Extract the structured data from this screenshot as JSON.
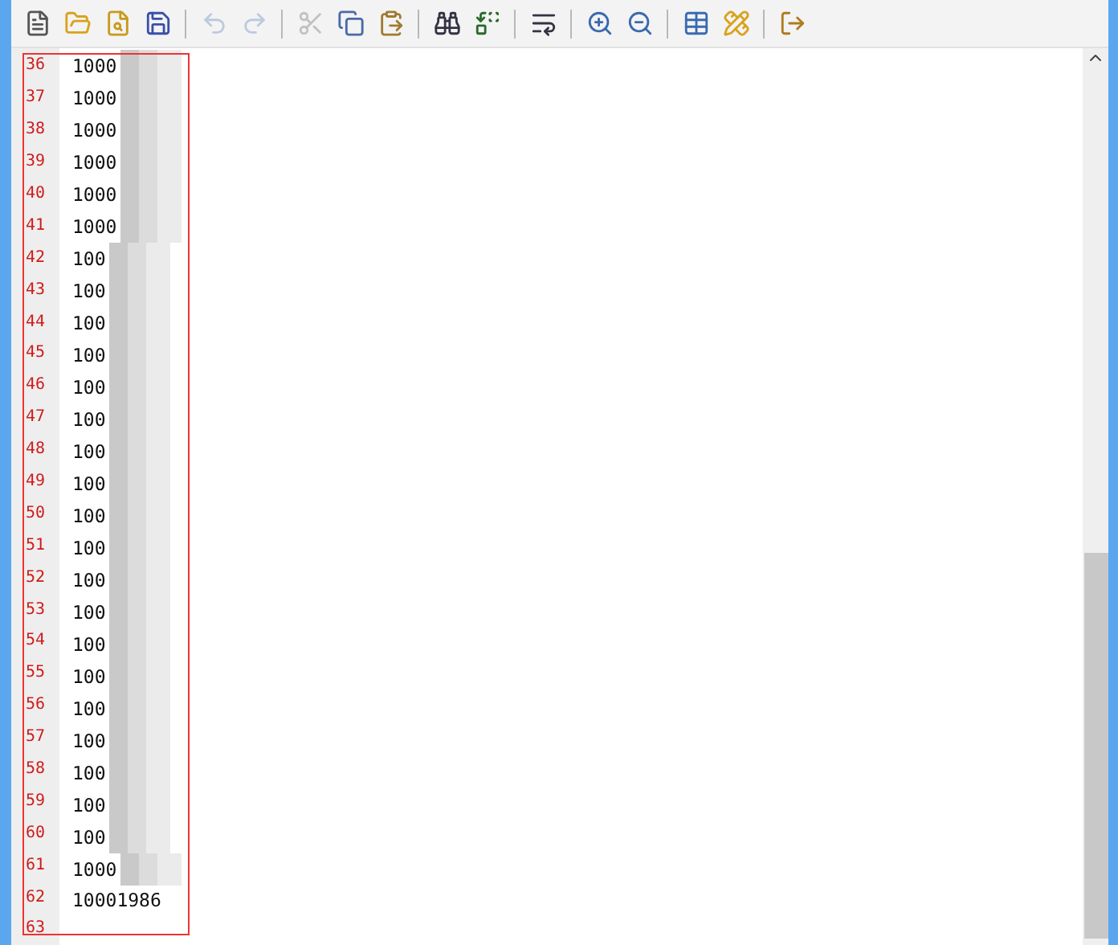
{
  "toolbar": [
    {
      "kind": "new"
    },
    {
      "kind": "open"
    },
    {
      "kind": "preview"
    },
    {
      "kind": "save"
    },
    {
      "kind": "sep"
    },
    {
      "kind": "undo",
      "disabled": true
    },
    {
      "kind": "redo",
      "disabled": true
    },
    {
      "kind": "sep"
    },
    {
      "kind": "cut",
      "disabled": true
    },
    {
      "kind": "copy"
    },
    {
      "kind": "paste"
    },
    {
      "kind": "sep"
    },
    {
      "kind": "find"
    },
    {
      "kind": "replace"
    },
    {
      "kind": "sep"
    },
    {
      "kind": "wrap"
    },
    {
      "kind": "sep"
    },
    {
      "kind": "zoomin"
    },
    {
      "kind": "zoomout"
    },
    {
      "kind": "sep"
    },
    {
      "kind": "table"
    },
    {
      "kind": "edit"
    },
    {
      "kind": "sep"
    },
    {
      "kind": "exit"
    }
  ],
  "lines": [
    {
      "number": "36",
      "text": "1000",
      "masked": true
    },
    {
      "number": "37",
      "text": "1000",
      "masked": true
    },
    {
      "number": "38",
      "text": "1000",
      "masked": true
    },
    {
      "number": "39",
      "text": "1000",
      "masked": true
    },
    {
      "number": "40",
      "text": "1000",
      "masked": true
    },
    {
      "number": "41",
      "text": "1000",
      "masked": true
    },
    {
      "number": "42",
      "text": "100",
      "masked": true
    },
    {
      "number": "43",
      "text": "100",
      "masked": true
    },
    {
      "number": "44",
      "text": "100",
      "masked": true
    },
    {
      "number": "45",
      "text": "100",
      "masked": true
    },
    {
      "number": "46",
      "text": "100",
      "masked": true
    },
    {
      "number": "47",
      "text": "100",
      "masked": true
    },
    {
      "number": "48",
      "text": "100",
      "masked": true
    },
    {
      "number": "49",
      "text": "100",
      "masked": true
    },
    {
      "number": "50",
      "text": "100",
      "masked": true
    },
    {
      "number": "51",
      "text": "100",
      "masked": true
    },
    {
      "number": "52",
      "text": "100",
      "masked": true
    },
    {
      "number": "53",
      "text": "100",
      "masked": true
    },
    {
      "number": "54",
      "text": "100",
      "masked": true
    },
    {
      "number": "55",
      "text": "100",
      "masked": true
    },
    {
      "number": "56",
      "text": "100",
      "masked": true
    },
    {
      "number": "57",
      "text": "100",
      "masked": true
    },
    {
      "number": "58",
      "text": "100",
      "masked": true
    },
    {
      "number": "59",
      "text": "100",
      "masked": true
    },
    {
      "number": "60",
      "text": "100",
      "masked": true
    },
    {
      "number": "61",
      "text": "1000",
      "masked": true
    },
    {
      "number": "62",
      "text": "10001986",
      "masked": false
    },
    {
      "number": "63",
      "masked": false
    }
  ]
}
